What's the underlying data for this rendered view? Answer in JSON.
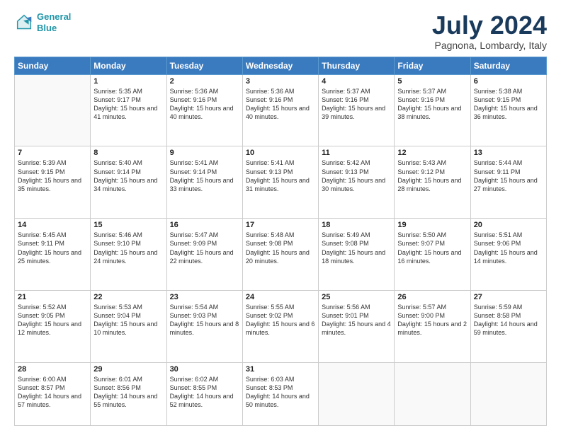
{
  "header": {
    "logo_line1": "General",
    "logo_line2": "Blue",
    "title": "July 2024",
    "subtitle": "Pagnona, Lombardy, Italy"
  },
  "columns": [
    "Sunday",
    "Monday",
    "Tuesday",
    "Wednesday",
    "Thursday",
    "Friday",
    "Saturday"
  ],
  "weeks": [
    [
      {
        "day": "",
        "sunrise": "",
        "sunset": "",
        "daylight": ""
      },
      {
        "day": "1",
        "sunrise": "Sunrise: 5:35 AM",
        "sunset": "Sunset: 9:17 PM",
        "daylight": "Daylight: 15 hours and 41 minutes."
      },
      {
        "day": "2",
        "sunrise": "Sunrise: 5:36 AM",
        "sunset": "Sunset: 9:16 PM",
        "daylight": "Daylight: 15 hours and 40 minutes."
      },
      {
        "day": "3",
        "sunrise": "Sunrise: 5:36 AM",
        "sunset": "Sunset: 9:16 PM",
        "daylight": "Daylight: 15 hours and 40 minutes."
      },
      {
        "day": "4",
        "sunrise": "Sunrise: 5:37 AM",
        "sunset": "Sunset: 9:16 PM",
        "daylight": "Daylight: 15 hours and 39 minutes."
      },
      {
        "day": "5",
        "sunrise": "Sunrise: 5:37 AM",
        "sunset": "Sunset: 9:16 PM",
        "daylight": "Daylight: 15 hours and 38 minutes."
      },
      {
        "day": "6",
        "sunrise": "Sunrise: 5:38 AM",
        "sunset": "Sunset: 9:15 PM",
        "daylight": "Daylight: 15 hours and 36 minutes."
      }
    ],
    [
      {
        "day": "7",
        "sunrise": "Sunrise: 5:39 AM",
        "sunset": "Sunset: 9:15 PM",
        "daylight": "Daylight: 15 hours and 35 minutes."
      },
      {
        "day": "8",
        "sunrise": "Sunrise: 5:40 AM",
        "sunset": "Sunset: 9:14 PM",
        "daylight": "Daylight: 15 hours and 34 minutes."
      },
      {
        "day": "9",
        "sunrise": "Sunrise: 5:41 AM",
        "sunset": "Sunset: 9:14 PM",
        "daylight": "Daylight: 15 hours and 33 minutes."
      },
      {
        "day": "10",
        "sunrise": "Sunrise: 5:41 AM",
        "sunset": "Sunset: 9:13 PM",
        "daylight": "Daylight: 15 hours and 31 minutes."
      },
      {
        "day": "11",
        "sunrise": "Sunrise: 5:42 AM",
        "sunset": "Sunset: 9:13 PM",
        "daylight": "Daylight: 15 hours and 30 minutes."
      },
      {
        "day": "12",
        "sunrise": "Sunrise: 5:43 AM",
        "sunset": "Sunset: 9:12 PM",
        "daylight": "Daylight: 15 hours and 28 minutes."
      },
      {
        "day": "13",
        "sunrise": "Sunrise: 5:44 AM",
        "sunset": "Sunset: 9:11 PM",
        "daylight": "Daylight: 15 hours and 27 minutes."
      }
    ],
    [
      {
        "day": "14",
        "sunrise": "Sunrise: 5:45 AM",
        "sunset": "Sunset: 9:11 PM",
        "daylight": "Daylight: 15 hours and 25 minutes."
      },
      {
        "day": "15",
        "sunrise": "Sunrise: 5:46 AM",
        "sunset": "Sunset: 9:10 PM",
        "daylight": "Daylight: 15 hours and 24 minutes."
      },
      {
        "day": "16",
        "sunrise": "Sunrise: 5:47 AM",
        "sunset": "Sunset: 9:09 PM",
        "daylight": "Daylight: 15 hours and 22 minutes."
      },
      {
        "day": "17",
        "sunrise": "Sunrise: 5:48 AM",
        "sunset": "Sunset: 9:08 PM",
        "daylight": "Daylight: 15 hours and 20 minutes."
      },
      {
        "day": "18",
        "sunrise": "Sunrise: 5:49 AM",
        "sunset": "Sunset: 9:08 PM",
        "daylight": "Daylight: 15 hours and 18 minutes."
      },
      {
        "day": "19",
        "sunrise": "Sunrise: 5:50 AM",
        "sunset": "Sunset: 9:07 PM",
        "daylight": "Daylight: 15 hours and 16 minutes."
      },
      {
        "day": "20",
        "sunrise": "Sunrise: 5:51 AM",
        "sunset": "Sunset: 9:06 PM",
        "daylight": "Daylight: 15 hours and 14 minutes."
      }
    ],
    [
      {
        "day": "21",
        "sunrise": "Sunrise: 5:52 AM",
        "sunset": "Sunset: 9:05 PM",
        "daylight": "Daylight: 15 hours and 12 minutes."
      },
      {
        "day": "22",
        "sunrise": "Sunrise: 5:53 AM",
        "sunset": "Sunset: 9:04 PM",
        "daylight": "Daylight: 15 hours and 10 minutes."
      },
      {
        "day": "23",
        "sunrise": "Sunrise: 5:54 AM",
        "sunset": "Sunset: 9:03 PM",
        "daylight": "Daylight: 15 hours and 8 minutes."
      },
      {
        "day": "24",
        "sunrise": "Sunrise: 5:55 AM",
        "sunset": "Sunset: 9:02 PM",
        "daylight": "Daylight: 15 hours and 6 minutes."
      },
      {
        "day": "25",
        "sunrise": "Sunrise: 5:56 AM",
        "sunset": "Sunset: 9:01 PM",
        "daylight": "Daylight: 15 hours and 4 minutes."
      },
      {
        "day": "26",
        "sunrise": "Sunrise: 5:57 AM",
        "sunset": "Sunset: 9:00 PM",
        "daylight": "Daylight: 15 hours and 2 minutes."
      },
      {
        "day": "27",
        "sunrise": "Sunrise: 5:59 AM",
        "sunset": "Sunset: 8:58 PM",
        "daylight": "Daylight: 14 hours and 59 minutes."
      }
    ],
    [
      {
        "day": "28",
        "sunrise": "Sunrise: 6:00 AM",
        "sunset": "Sunset: 8:57 PM",
        "daylight": "Daylight: 14 hours and 57 minutes."
      },
      {
        "day": "29",
        "sunrise": "Sunrise: 6:01 AM",
        "sunset": "Sunset: 8:56 PM",
        "daylight": "Daylight: 14 hours and 55 minutes."
      },
      {
        "day": "30",
        "sunrise": "Sunrise: 6:02 AM",
        "sunset": "Sunset: 8:55 PM",
        "daylight": "Daylight: 14 hours and 52 minutes."
      },
      {
        "day": "31",
        "sunrise": "Sunrise: 6:03 AM",
        "sunset": "Sunset: 8:53 PM",
        "daylight": "Daylight: 14 hours and 50 minutes."
      },
      {
        "day": "",
        "sunrise": "",
        "sunset": "",
        "daylight": ""
      },
      {
        "day": "",
        "sunrise": "",
        "sunset": "",
        "daylight": ""
      },
      {
        "day": "",
        "sunrise": "",
        "sunset": "",
        "daylight": ""
      }
    ]
  ]
}
